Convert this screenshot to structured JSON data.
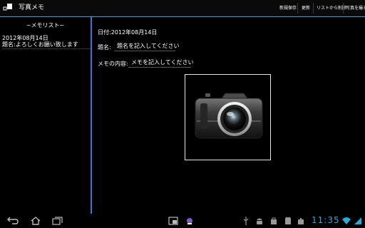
{
  "app": {
    "title": "写真メモ"
  },
  "menu": [
    {
      "label": "新規保存"
    },
    {
      "label": "更新"
    },
    {
      "label": "リストから削除"
    },
    {
      "label": "写真を撮る"
    }
  ],
  "memo_list": {
    "title": "~メモリスト~",
    "items": [
      {
        "date": "2012年08月14日",
        "title": "題名:よろしくお願い致します"
      }
    ]
  },
  "detail": {
    "date_label": "日付:2012年08月14日",
    "title_label": "題名:",
    "title_placeholder": "題名を記入してください",
    "memo_label": "メモの内容:",
    "memo_placeholder": "メモを記入してください",
    "photo_icon": "camera-icon"
  },
  "status_bar": {
    "clock": "11:35",
    "icons": [
      "usb-icon",
      "android-icon",
      "bag-icon",
      "wifi-icon",
      "battery-icon"
    ]
  },
  "nav": {
    "buttons": [
      "back-icon",
      "home-icon",
      "recent-apps-icon",
      "screenshot-icon",
      "app-icon"
    ]
  },
  "colors": {
    "accent": "#2fa8d8",
    "divider": "#2f7fd0",
    "background": "#000000"
  }
}
